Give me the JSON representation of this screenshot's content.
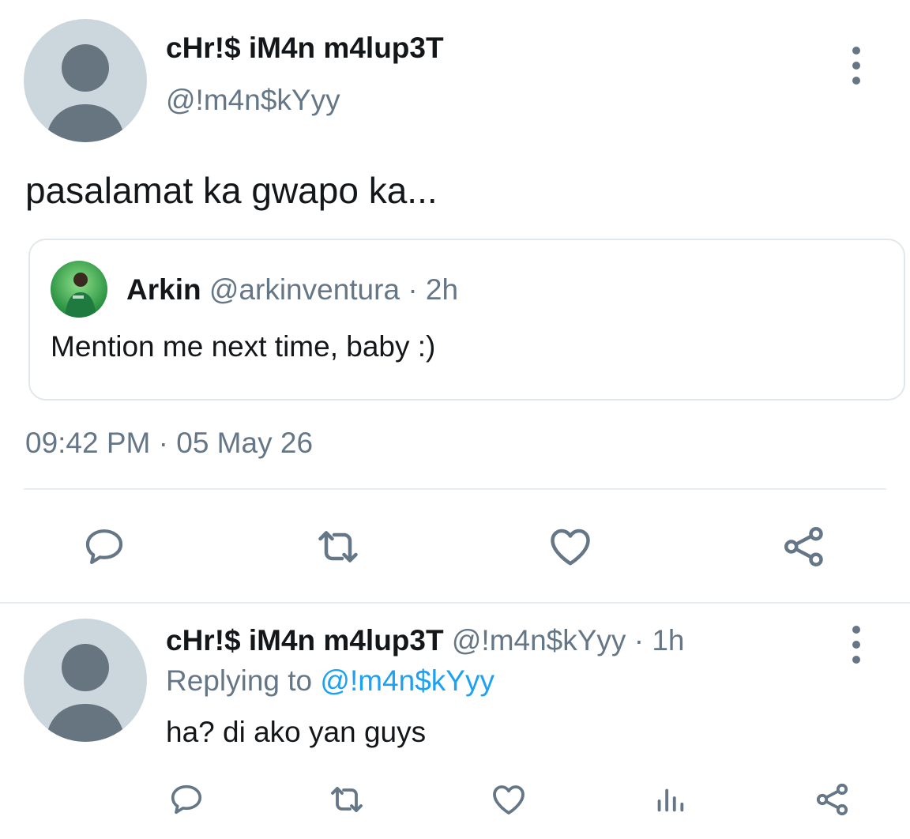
{
  "main_tweet": {
    "display_name": "cHr!$ iM4n m4lup3T",
    "handle": "@!m4n$kYyy",
    "text": "pasalamat ka gwapo ka...",
    "timestamp": "09:42 PM · 05 May 26",
    "avatar_icon": "default-profile-icon",
    "menu_icon": "more-vertical-icon",
    "quoted_tweet": {
      "display_name": "Arkin",
      "handle": "@arkinventura",
      "separator": "·",
      "time": "2h",
      "text": "Mention me next time, baby :)",
      "avatar_icon": "profile-photo"
    },
    "actions": [
      {
        "name": "reply",
        "icon": "reply-icon"
      },
      {
        "name": "retweet",
        "icon": "retweet-icon"
      },
      {
        "name": "like",
        "icon": "heart-icon"
      },
      {
        "name": "share",
        "icon": "share-icon"
      }
    ]
  },
  "reply_tweet": {
    "display_name": "cHr!$ iM4n m4lup3T",
    "handle": "@!m4n$kYyy",
    "separator": "·",
    "time": "1h",
    "replying_to_label": "Replying to",
    "replying_to_handle": "@!m4n$kYyy",
    "text": "ha? di ako yan guys",
    "avatar_icon": "default-profile-icon",
    "menu_icon": "more-vertical-icon",
    "actions": [
      {
        "name": "reply",
        "icon": "reply-icon"
      },
      {
        "name": "retweet",
        "icon": "retweet-icon"
      },
      {
        "name": "like",
        "icon": "heart-icon"
      },
      {
        "name": "analytics",
        "icon": "analytics-icon"
      },
      {
        "name": "share",
        "icon": "share-icon"
      }
    ]
  },
  "colors": {
    "text": "#14171a",
    "muted": "#657786",
    "link": "#1da1f2",
    "border": "#e1e8ed",
    "avatar_bg": "#ccd6dd",
    "avatar_fg": "#66757f",
    "icon": "#657786"
  }
}
